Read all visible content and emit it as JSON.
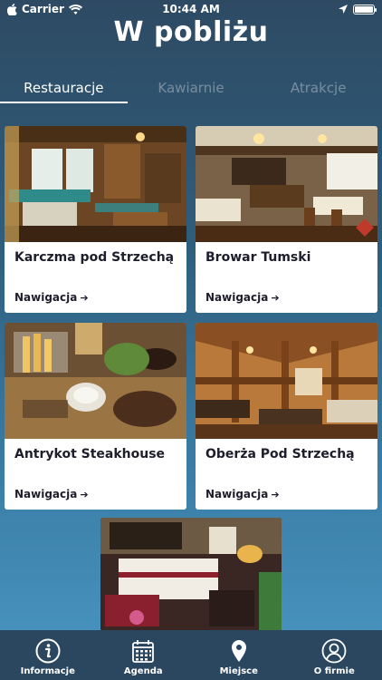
{
  "status_bar": {
    "carrier": "Carrier",
    "time": "10:44 AM"
  },
  "header": {
    "title": "W pobliżu"
  },
  "tabs": [
    {
      "label": "Restauracje",
      "active": true
    },
    {
      "label": "Kawiarnie",
      "active": false
    },
    {
      "label": "Atrakcje",
      "active": false
    }
  ],
  "places": [
    {
      "name": "Karczma pod Strzechą",
      "nav_label": "Nawigacja"
    },
    {
      "name": "Browar Tumski",
      "nav_label": "Nawigacja"
    },
    {
      "name": "Antrykot Steakhouse",
      "nav_label": "Nawigacja"
    },
    {
      "name": "Oberża Pod Strzechą",
      "nav_label": "Nawigacja"
    }
  ],
  "tabbar": [
    {
      "label": "Informacje",
      "icon": "info-icon"
    },
    {
      "label": "Agenda",
      "icon": "calendar-icon"
    },
    {
      "label": "Miejsce",
      "icon": "location-pin-icon"
    },
    {
      "label": "O firmie",
      "icon": "user-icon"
    }
  ]
}
